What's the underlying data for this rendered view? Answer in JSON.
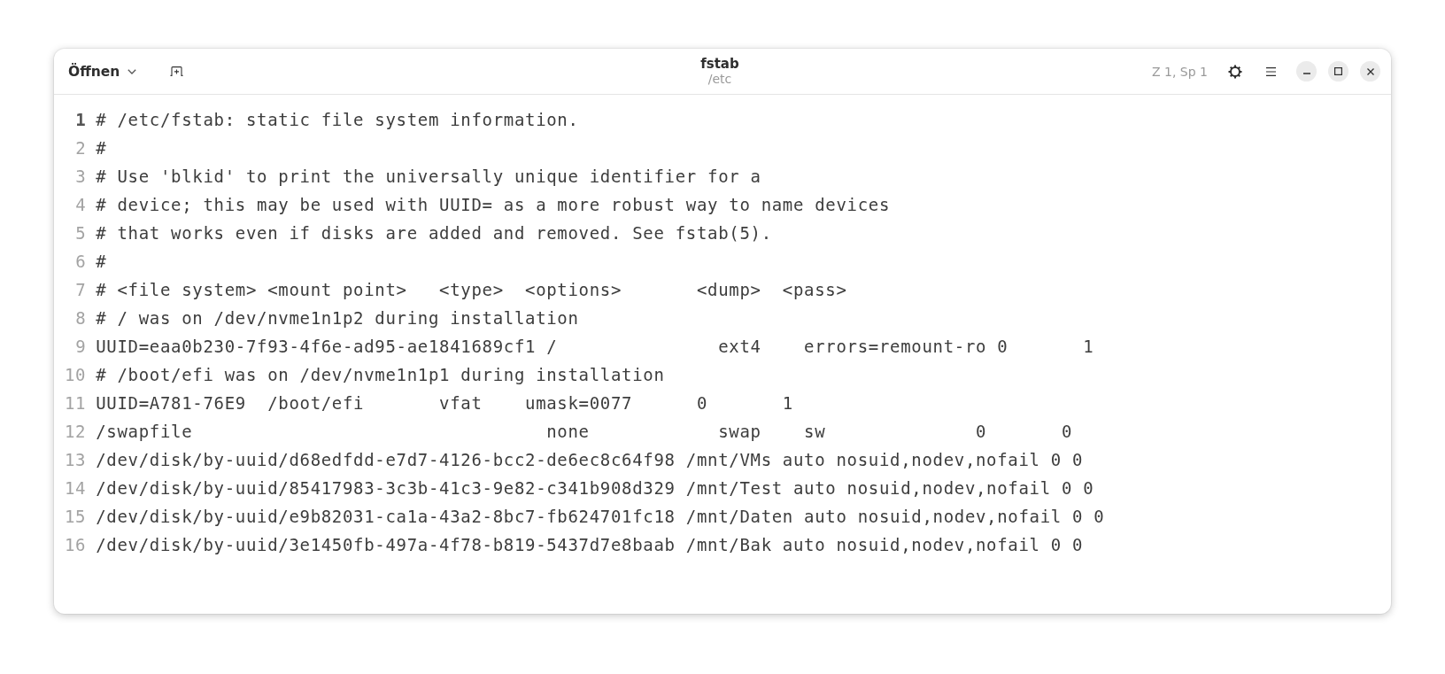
{
  "window": {
    "title": "fstab",
    "subtitle": "/etc"
  },
  "header": {
    "open_button": "Öffnen",
    "cursor_position": "Z 1, Sp 1"
  },
  "editor": {
    "lines": [
      {
        "number": "1",
        "text": "# /etc/fstab: static file system information.",
        "current": true
      },
      {
        "number": "2",
        "text": "#",
        "current": false
      },
      {
        "number": "3",
        "text": "# Use 'blkid' to print the universally unique identifier for a",
        "current": false
      },
      {
        "number": "4",
        "text": "# device; this may be used with UUID= as a more robust way to name devices",
        "current": false
      },
      {
        "number": "5",
        "text": "# that works even if disks are added and removed. See fstab(5).",
        "current": false
      },
      {
        "number": "6",
        "text": "#",
        "current": false
      },
      {
        "number": "7",
        "text": "# <file system> <mount point>   <type>  <options>       <dump>  <pass>",
        "current": false
      },
      {
        "number": "8",
        "text": "# / was on /dev/nvme1n1p2 during installation",
        "current": false
      },
      {
        "number": "9",
        "text": "UUID=eaa0b230-7f93-4f6e-ad95-ae1841689cf1 /               ext4    errors=remount-ro 0       1",
        "current": false
      },
      {
        "number": "10",
        "text": "# /boot/efi was on /dev/nvme1n1p1 during installation",
        "current": false
      },
      {
        "number": "11",
        "text": "UUID=A781-76E9  /boot/efi       vfat    umask=0077      0       1",
        "current": false
      },
      {
        "number": "12",
        "text": "/swapfile                                 none            swap    sw              0       0",
        "current": false
      },
      {
        "number": "13",
        "text": "/dev/disk/by-uuid/d68edfdd-e7d7-4126-bcc2-de6ec8c64f98 /mnt/VMs auto nosuid,nodev,nofail 0 0",
        "current": false
      },
      {
        "number": "14",
        "text": "/dev/disk/by-uuid/85417983-3c3b-41c3-9e82-c341b908d329 /mnt/Test auto nosuid,nodev,nofail 0 0",
        "current": false
      },
      {
        "number": "15",
        "text": "/dev/disk/by-uuid/e9b82031-ca1a-43a2-8bc7-fb624701fc18 /mnt/Daten auto nosuid,nodev,nofail 0 0",
        "current": false
      },
      {
        "number": "16",
        "text": "/dev/disk/by-uuid/3e1450fb-497a-4f78-b819-5437d7e8baab /mnt/Bak auto nosuid,nodev,nofail 0 0",
        "current": false
      }
    ]
  }
}
